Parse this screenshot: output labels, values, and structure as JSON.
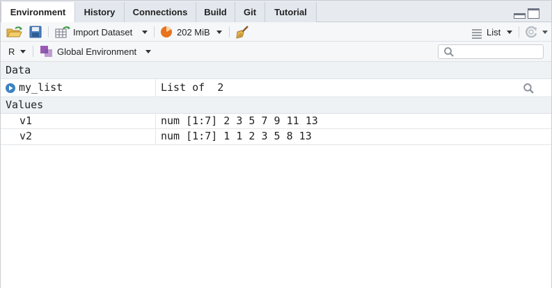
{
  "tabs": [
    {
      "label": "Environment",
      "active": true
    },
    {
      "label": "History",
      "active": false
    },
    {
      "label": "Connections",
      "active": false
    },
    {
      "label": "Build",
      "active": false
    },
    {
      "label": "Git",
      "active": false
    },
    {
      "label": "Tutorial",
      "active": false
    }
  ],
  "toolbar": {
    "import_label": "Import Dataset",
    "memory_label": "202 MiB",
    "view_label": "List"
  },
  "toolbar2": {
    "language_label": "R",
    "env_label": "Global Environment",
    "search_placeholder": ""
  },
  "data_section": {
    "title": "Data",
    "items": [
      {
        "name": "my_list",
        "value": "List of  2"
      }
    ]
  },
  "values_section": {
    "title": "Values",
    "items": [
      {
        "name": "v1",
        "value": "num [1:7] 2 3 5 7 9 11 13"
      },
      {
        "name": "v2",
        "value": "num [1:7] 1 1 2 3 5 8 13"
      }
    ]
  },
  "colors": {
    "accent_blue": "#3b82c4",
    "memory_orange": "#e8731a",
    "section_bg": "#eef2f5"
  }
}
